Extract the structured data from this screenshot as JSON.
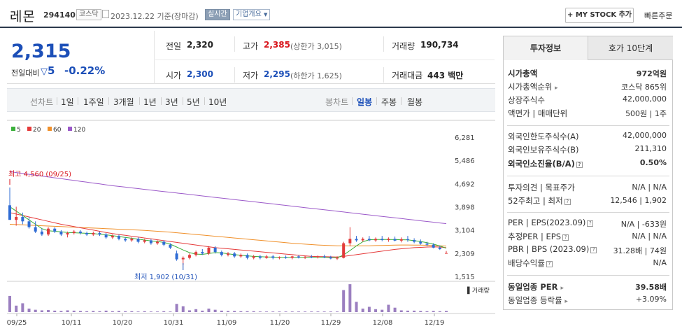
{
  "header": {
    "name": "레몬",
    "code": "294140",
    "market": "코스닥",
    "date": "2023.12.22  기준(장마감)",
    "realtime": "실시간",
    "corp_overview": "기업개요",
    "mystock": "MY STOCK 추가",
    "quick_order": "빠른주문"
  },
  "summary": {
    "price": "2,315",
    "change_label": "전일대비",
    "change_value": "5",
    "change_pct": "-0.22%",
    "prev_label": "전일",
    "prev_value": "2,320",
    "high_label": "고가",
    "high_value": "2,385",
    "upper_limit": "(상한가 3,015)",
    "volume_label": "거래량",
    "volume_value": "190,734",
    "open_label": "시가",
    "open_value": "2,300",
    "low_label": "저가",
    "low_value": "2,295",
    "lower_limit": "(하한가 1,625)",
    "amount_label": "거래대금",
    "amount_value": "443 백만"
  },
  "toolbar": {
    "line_label": "선차트",
    "periods": [
      "1일",
      "1주일",
      "3개월",
      "1년",
      "3년",
      "5년",
      "10년"
    ],
    "candle_label": "봉차트",
    "candle_periods": [
      "일봉",
      "주봉",
      "월봉"
    ]
  },
  "chart_data": {
    "type": "candlestick",
    "legend": [
      "5",
      "20",
      "60",
      "120"
    ],
    "colors": {
      "ma5": "#3ab03a",
      "ma20": "#e53a3a",
      "ma60": "#f0902a",
      "ma120": "#9b59c9",
      "up": "#e23a3a",
      "down": "#2f6cd4",
      "volume": "#9b7fc0"
    },
    "y_ticks": [
      "6,281",
      "5,486",
      "4,692",
      "3,898",
      "3,104",
      "2,309",
      "1,515"
    ],
    "ylim": [
      1515,
      6281
    ],
    "x_ticks": [
      "09/25",
      "10/11",
      "10/20",
      "10/31",
      "11/09",
      "11/20",
      "11/29",
      "12/08",
      "12/19"
    ],
    "high_annotation": "최고 4,560 (09/25)",
    "low_annotation": "최저 1,902 (10/31)",
    "volume_label": "거래량",
    "candles": [
      [
        3950,
        4560,
        3500,
        3450
      ],
      [
        3450,
        3900,
        3250,
        3550
      ],
      [
        3550,
        3700,
        3300,
        3400
      ],
      [
        3400,
        3550,
        3150,
        3200
      ],
      [
        3200,
        3400,
        3000,
        3050
      ],
      [
        3050,
        3150,
        2900,
        2950
      ],
      [
        2950,
        3200,
        2900,
        3150
      ],
      [
        3150,
        3200,
        3000,
        3050
      ],
      [
        3050,
        3100,
        2900,
        2950
      ],
      [
        2950,
        3050,
        2850,
        3000
      ],
      [
        3000,
        3100,
        2950,
        3050
      ],
      [
        3050,
        3100,
        2950,
        3000
      ],
      [
        3000,
        3050,
        2900,
        2950
      ],
      [
        2950,
        3050,
        2900,
        3000
      ],
      [
        3000,
        3050,
        2900,
        2950
      ],
      [
        2950,
        3000,
        2800,
        2850
      ],
      [
        2850,
        2950,
        2800,
        2900
      ],
      [
        2900,
        2950,
        2750,
        2800
      ],
      [
        2800,
        2850,
        2700,
        2750
      ],
      [
        2750,
        2850,
        2700,
        2800
      ],
      [
        2800,
        2850,
        2650,
        2700
      ],
      [
        2700,
        2800,
        2650,
        2750
      ],
      [
        2750,
        2800,
        2600,
        2650
      ],
      [
        2650,
        2750,
        2600,
        2700
      ],
      [
        2700,
        2750,
        2550,
        2600
      ],
      [
        2600,
        2650,
        2450,
        2500
      ],
      [
        2300,
        2400,
        2050,
        2100
      ],
      [
        2100,
        2200,
        1902,
        2150
      ],
      [
        2150,
        2300,
        2100,
        2250
      ],
      [
        2250,
        2400,
        2200,
        2350
      ],
      [
        2350,
        2450,
        2250,
        2300
      ],
      [
        2300,
        2550,
        2250,
        2500
      ],
      [
        2500,
        2550,
        2300,
        2350
      ],
      [
        2350,
        2400,
        2200,
        2250
      ],
      [
        2250,
        2350,
        2200,
        2300
      ],
      [
        2300,
        2350,
        2150,
        2200
      ],
      [
        2200,
        2300,
        2150,
        2250
      ],
      [
        2250,
        2300,
        2100,
        2150
      ],
      [
        2150,
        2250,
        2100,
        2200
      ],
      [
        2200,
        2250,
        2100,
        2150
      ],
      [
        2150,
        2250,
        2120,
        2200
      ],
      [
        2200,
        2250,
        2100,
        2150
      ],
      [
        2150,
        2200,
        2100,
        2180
      ],
      [
        2180,
        2230,
        2120,
        2150
      ],
      [
        2150,
        2220,
        2100,
        2200
      ],
      [
        2200,
        2240,
        2130,
        2160
      ],
      [
        2160,
        2210,
        2110,
        2190
      ],
      [
        2190,
        2250,
        2140,
        2170
      ],
      [
        2170,
        2230,
        2130,
        2200
      ],
      [
        2200,
        2260,
        2140,
        2170
      ],
      [
        2170,
        2220,
        2100,
        2130
      ],
      [
        2130,
        2200,
        2080,
        2150
      ],
      [
        2150,
        2700,
        2130,
        2650
      ],
      [
        2650,
        3200,
        2550,
        2800
      ],
      [
        2800,
        2900,
        2700,
        2750
      ],
      [
        2750,
        2850,
        2700,
        2800
      ],
      [
        2800,
        2900,
        2720,
        2750
      ],
      [
        2750,
        2850,
        2700,
        2800
      ],
      [
        2800,
        2900,
        2720,
        2760
      ],
      [
        2760,
        2850,
        2700,
        2800
      ],
      [
        2800,
        2880,
        2720,
        2740
      ],
      [
        2740,
        2850,
        2680,
        2790
      ],
      [
        2790,
        2900,
        2700,
        2760
      ],
      [
        2760,
        2820,
        2650,
        2700
      ],
      [
        2700,
        2780,
        2600,
        2640
      ],
      [
        2640,
        2700,
        2550,
        2600
      ],
      [
        2600,
        2650,
        2480,
        2500
      ],
      [
        2500,
        2560,
        2420,
        2450
      ],
      [
        2300,
        2385,
        2295,
        2315
      ]
    ],
    "ma5": [
      3900,
      3750,
      3600,
      3450,
      3300,
      3150,
      3080,
      3060,
      3040,
      3020,
      3010,
      3000,
      2990,
      2980,
      2960,
      2940,
      2910,
      2880,
      2850,
      2820,
      2790,
      2760,
      2730,
      2710,
      2680,
      2620,
      2520,
      2420,
      2330,
      2280,
      2270,
      2300,
      2330,
      2320,
      2290,
      2260,
      2240,
      2220,
      2200,
      2190,
      2180,
      2175,
      2170,
      2168,
      2165,
      2168,
      2170,
      2172,
      2175,
      2170,
      2160,
      2150,
      2250,
      2400,
      2560,
      2700,
      2770,
      2780,
      2780,
      2780,
      2775,
      2770,
      2765,
      2740,
      2710,
      2670,
      2620,
      2560,
      2480
    ],
    "ma20": [
      3700,
      3650,
      3600,
      3550,
      3500,
      3450,
      3400,
      3350,
      3300,
      3260,
      3220,
      3180,
      3140,
      3100,
      3060,
      3020,
      2980,
      2950,
      2920,
      2890,
      2860,
      2830,
      2800,
      2770,
      2740,
      2710,
      2680,
      2650,
      2620,
      2590,
      2560,
      2530,
      2500,
      2480,
      2460,
      2440,
      2420,
      2400,
      2380,
      2360,
      2340,
      2320,
      2300,
      2280,
      2260,
      2240,
      2220,
      2200,
      2195,
      2190,
      2185,
      2180,
      2200,
      2230,
      2260,
      2290,
      2320,
      2350,
      2380,
      2410,
      2440,
      2460,
      2480,
      2500,
      2510,
      2520,
      2525,
      2520,
      2500
    ],
    "ma60": [
      3300,
      3290,
      3280,
      3270,
      3260,
      3250,
      3240,
      3230,
      3220,
      3210,
      3200,
      3190,
      3180,
      3170,
      3160,
      3150,
      3140,
      3130,
      3120,
      3110,
      3100,
      3090,
      3075,
      3060,
      3045,
      3030,
      3010,
      2990,
      2970,
      2950,
      2930,
      2910,
      2890,
      2870,
      2850,
      2830,
      2810,
      2790,
      2770,
      2750,
      2730,
      2710,
      2690,
      2670,
      2650,
      2635,
      2620,
      2605,
      2590,
      2580,
      2570,
      2565,
      2562,
      2560,
      2560,
      2562,
      2565,
      2570,
      2575,
      2580,
      2585,
      2590,
      2590,
      2588,
      2585,
      2580,
      2575,
      2565,
      2555
    ],
    "ma120": [
      5100,
      5070,
      5040,
      5010,
      4980,
      4950,
      4920,
      4890,
      4860,
      4830,
      4800,
      4770,
      4740,
      4710,
      4680,
      4650,
      4620,
      4595,
      4570,
      4545,
      4520,
      4495,
      4470,
      4445,
      4420,
      4395,
      4370,
      4345,
      4320,
      4295,
      4270,
      4245,
      4220,
      4195,
      4170,
      4145,
      4120,
      4095,
      4070,
      4045,
      4020,
      3995,
      3970,
      3945,
      3920,
      3895,
      3870,
      3845,
      3820,
      3795,
      3770,
      3745,
      3720,
      3695,
      3670,
      3645,
      3620,
      3595,
      3570,
      3545,
      3520,
      3495,
      3470,
      3445,
      3420,
      3395,
      3370,
      3345,
      3320
    ],
    "volume": [
      0.55,
      0.22,
      0.3,
      0.12,
      0.08,
      0.06,
      0.07,
      0.05,
      0.04,
      0.06,
      0.05,
      0.04,
      0.03,
      0.04,
      0.03,
      0.05,
      0.03,
      0.04,
      0.03,
      0.03,
      0.02,
      0.03,
      0.02,
      0.02,
      0.03,
      0.02,
      0.28,
      0.2,
      0.06,
      0.1,
      0.05,
      0.12,
      0.08,
      0.05,
      0.04,
      0.04,
      0.03,
      0.03,
      0.03,
      0.02,
      0.02,
      0.02,
      0.02,
      0.02,
      0.02,
      0.02,
      0.02,
      0.02,
      0.02,
      0.02,
      0.02,
      0.02,
      0.75,
      0.95,
      0.35,
      0.12,
      0.18,
      0.1,
      0.08,
      0.25,
      0.15,
      0.06,
      0.05,
      0.05,
      0.04,
      0.03,
      0.04,
      0.03,
      0.04
    ]
  },
  "invest": {
    "tab_info": "투자정보",
    "tab_orderbook": "호가 10단계",
    "market_cap_label": "시가총액",
    "market_cap_value": "972억원",
    "rank_label": "시가총액순위",
    "rank_value": "코스닥 865위",
    "shares_label": "상장주식수",
    "shares_value": "42,000,000",
    "par_label": "액면가 | 매매단위",
    "par_value": "500원 | 1주",
    "foreign_limit_label": "외국인한도주식수(A)",
    "foreign_limit_value": "42,000,000",
    "foreign_hold_label": "외국인보유주식수(B)",
    "foreign_hold_value": "211,310",
    "foreign_ratio_label": "외국인소진율(B/A)",
    "foreign_ratio_value": "0.50%",
    "opinion_label": "투자의견 | 목표주가",
    "opinion_value": "N/A | N/A",
    "week52_label": "52주최고 | 최저",
    "week52_value": "12,546 | 1,902",
    "per_label": "PER | EPS(2023.09)",
    "per_value": "N/A | -633원",
    "est_label": "추정PER | EPS",
    "est_value": "N/A | N/A",
    "pbr_label": "PBR | BPS (2023.09)",
    "pbr_value": "31.28배 | 74원",
    "div_label": "배당수익률",
    "div_value": "N/A",
    "sector_per_label": "동일업종 PER",
    "sector_per_value": "39.58배",
    "sector_chg_label": "동일업종 등락률",
    "sector_chg_value": "+3.09%"
  }
}
